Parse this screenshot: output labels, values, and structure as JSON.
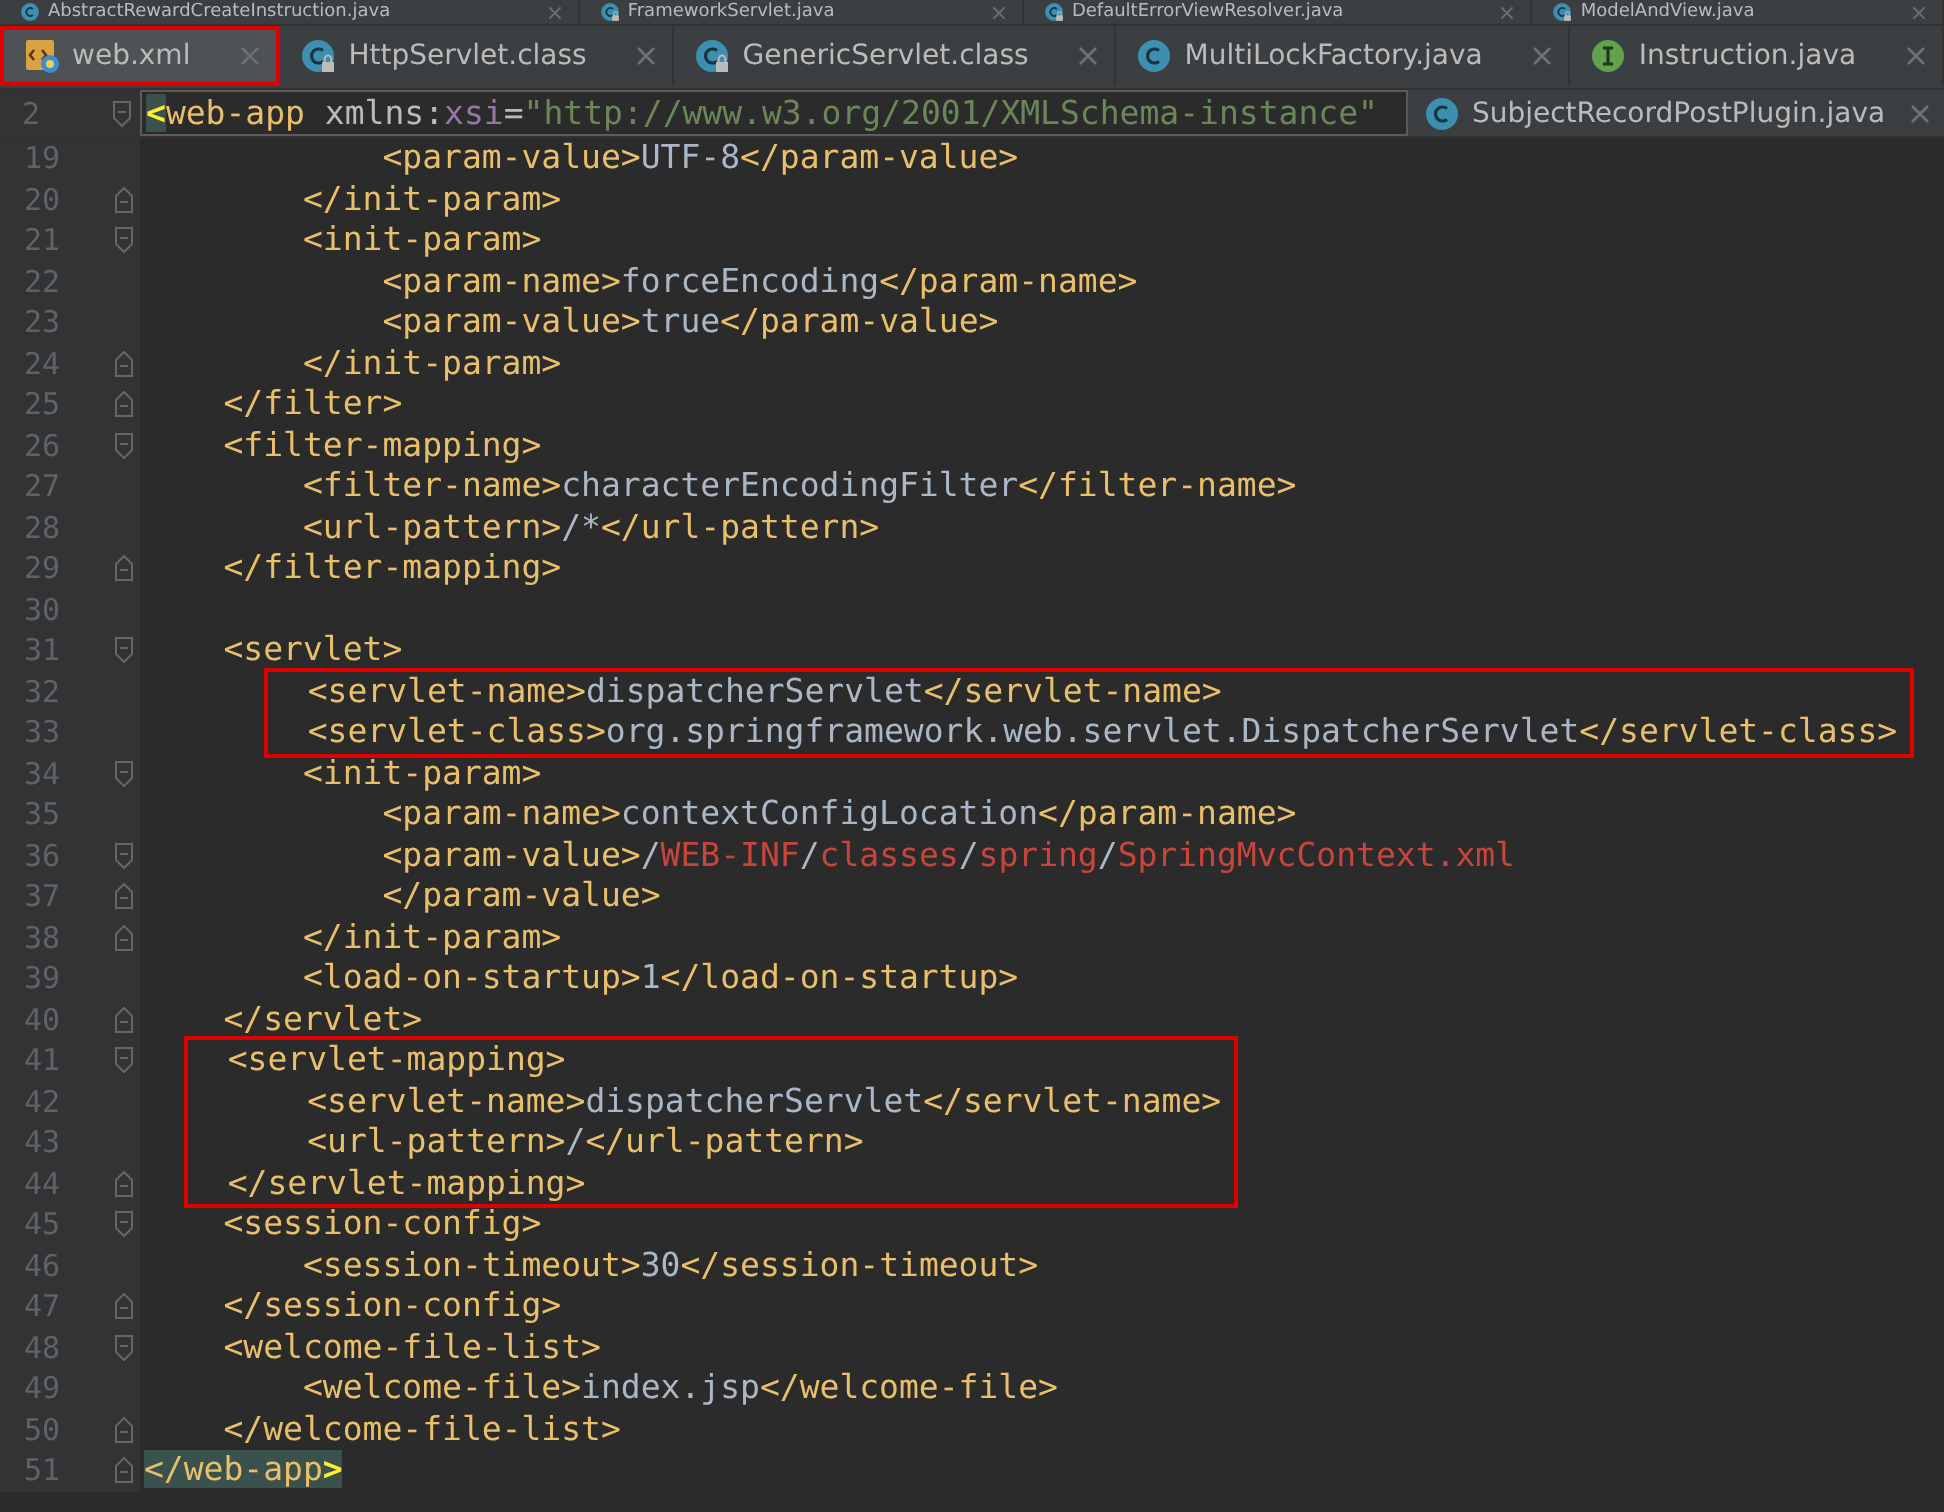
{
  "tab_rows": [
    [
      {
        "label": "AbstractRewardCreateInstruction.java",
        "kind": "class",
        "locked": false,
        "selected": false,
        "boxed": false
      },
      {
        "label": "FrameworkServlet.java",
        "kind": "class",
        "locked": true,
        "selected": false,
        "boxed": false
      },
      {
        "label": "DefaultErrorViewResolver.java",
        "kind": "class",
        "locked": true,
        "selected": false,
        "boxed": false
      },
      {
        "label": "ModelAndView.java",
        "kind": "class",
        "locked": true,
        "selected": false,
        "boxed": false
      }
    ],
    [
      {
        "label": "web.xml",
        "kind": "xml",
        "locked": false,
        "selected": true,
        "boxed": true
      },
      {
        "label": "HttpServlet.class",
        "kind": "class",
        "locked": true,
        "selected": false,
        "boxed": false
      },
      {
        "label": "GenericServlet.class",
        "kind": "class",
        "locked": true,
        "selected": false,
        "boxed": false
      },
      {
        "label": "MultiLockFactory.java",
        "kind": "class",
        "locked": false,
        "selected": false,
        "boxed": false
      },
      {
        "label": "Instruction.java",
        "kind": "interface",
        "locked": false,
        "selected": false,
        "boxed": false
      }
    ]
  ],
  "sticky_line": {
    "number": "2",
    "fold_start": true,
    "fold_end": false,
    "tokens": [
      {
        "kind": "match-brace",
        "text": "<"
      },
      {
        "kind": "tag",
        "text": "web-app "
      },
      {
        "kind": "attr",
        "text": "xmlns:"
      },
      {
        "kind": "ns",
        "text": "xsi"
      },
      {
        "kind": "attr",
        "text": "="
      },
      {
        "kind": "string",
        "text": "\"http://www.w3.org/2001/XMLSchema-instance\""
      }
    ]
  },
  "side_tab": {
    "label": "SubjectRecordPostPlugin.java",
    "kind": "class",
    "locked": false,
    "selected": false,
    "boxed": false
  },
  "code_blocks": [
    {
      "boxed": false,
      "lines": [
        {
          "number": "19",
          "fold_start": false,
          "fold_end": false,
          "tokens": [
            {
              "kind": "tag",
              "text": "            <param-value>"
            },
            {
              "kind": "text",
              "text": "UTF-8"
            },
            {
              "kind": "tag",
              "text": "</param-value>"
            }
          ]
        },
        {
          "number": "20",
          "fold_start": false,
          "fold_end": true,
          "tokens": [
            {
              "kind": "tag",
              "text": "        </init-param>"
            }
          ]
        },
        {
          "number": "21",
          "fold_start": true,
          "fold_end": false,
          "tokens": [
            {
              "kind": "tag",
              "text": "        <init-param>"
            }
          ]
        },
        {
          "number": "22",
          "fold_start": false,
          "fold_end": false,
          "tokens": [
            {
              "kind": "tag",
              "text": "            <param-name>"
            },
            {
              "kind": "text",
              "text": "forceEncoding"
            },
            {
              "kind": "tag",
              "text": "</param-name>"
            }
          ]
        },
        {
          "number": "23",
          "fold_start": false,
          "fold_end": false,
          "tokens": [
            {
              "kind": "tag",
              "text": "            <param-value>"
            },
            {
              "kind": "text",
              "text": "true"
            },
            {
              "kind": "tag",
              "text": "</param-value>"
            }
          ]
        },
        {
          "number": "24",
          "fold_start": false,
          "fold_end": true,
          "tokens": [
            {
              "kind": "tag",
              "text": "        </init-param>"
            }
          ]
        },
        {
          "number": "25",
          "fold_start": false,
          "fold_end": true,
          "tokens": [
            {
              "kind": "tag",
              "text": "    </filter>"
            }
          ]
        },
        {
          "number": "26",
          "fold_start": true,
          "fold_end": false,
          "tokens": [
            {
              "kind": "tag",
              "text": "    <filter-mapping>"
            }
          ]
        },
        {
          "number": "27",
          "fold_start": false,
          "fold_end": false,
          "tokens": [
            {
              "kind": "tag",
              "text": "        <filter-name>"
            },
            {
              "kind": "text",
              "text": "characterEncodingFilter"
            },
            {
              "kind": "tag",
              "text": "</filter-name>"
            }
          ]
        },
        {
          "number": "28",
          "fold_start": false,
          "fold_end": false,
          "tokens": [
            {
              "kind": "tag",
              "text": "        <url-pattern>"
            },
            {
              "kind": "text",
              "text": "/*"
            },
            {
              "kind": "tag",
              "text": "</url-pattern>"
            }
          ]
        },
        {
          "number": "29",
          "fold_start": false,
          "fold_end": true,
          "tokens": [
            {
              "kind": "tag",
              "text": "    </filter-mapping>"
            }
          ]
        },
        {
          "number": "30",
          "fold_start": false,
          "fold_end": false
        },
        {
          "number": "31",
          "fold_start": true,
          "fold_end": false,
          "tokens": [
            {
              "kind": "tag",
              "text": "    <servlet>"
            }
          ]
        }
      ]
    },
    {
      "boxed": true,
      "lines": [
        {
          "number": "32",
          "fold_start": false,
          "fold_end": false,
          "tokens": [
            {
              "kind": "tag",
              "text": "        <servlet-name>"
            },
            {
              "kind": "text",
              "text": "dispatcherServlet"
            },
            {
              "kind": "tag",
              "text": "</servlet-name>"
            }
          ]
        },
        {
          "number": "33",
          "fold_start": false,
          "fold_end": false,
          "tokens": [
            {
              "kind": "tag",
              "text": "        <servlet-class>"
            },
            {
              "kind": "text",
              "text": "org.springframework.web.servlet.DispatcherServlet"
            },
            {
              "kind": "tag",
              "text": "</servlet-class>"
            }
          ]
        }
      ]
    },
    {
      "boxed": false,
      "lines": [
        {
          "number": "34",
          "fold_start": true,
          "fold_end": false,
          "tokens": [
            {
              "kind": "tag",
              "text": "        <init-param>"
            }
          ]
        },
        {
          "number": "35",
          "fold_start": false,
          "fold_end": false,
          "tokens": [
            {
              "kind": "tag",
              "text": "            <param-name>"
            },
            {
              "kind": "text",
              "text": "contextConfigLocation"
            },
            {
              "kind": "tag",
              "text": "</param-name>"
            }
          ]
        },
        {
          "number": "36",
          "fold_start": true,
          "fold_end": false,
          "tokens": [
            {
              "kind": "tag",
              "text": "            <param-value>"
            },
            {
              "kind": "text",
              "text": "/"
            },
            {
              "kind": "path",
              "text": "WEB-INF"
            },
            {
              "kind": "text",
              "text": "/"
            },
            {
              "kind": "path",
              "text": "classes"
            },
            {
              "kind": "text",
              "text": "/"
            },
            {
              "kind": "path",
              "text": "spring"
            },
            {
              "kind": "text",
              "text": "/"
            },
            {
              "kind": "path",
              "text": "SpringMvcContext.xml"
            }
          ]
        },
        {
          "number": "37",
          "fold_start": false,
          "fold_end": true,
          "tokens": [
            {
              "kind": "tag",
              "text": "            </param-value>"
            }
          ]
        },
        {
          "number": "38",
          "fold_start": false,
          "fold_end": true,
          "tokens": [
            {
              "kind": "tag",
              "text": "        </init-param>"
            }
          ]
        },
        {
          "number": "39",
          "fold_start": false,
          "fold_end": false,
          "tokens": [
            {
              "kind": "tag",
              "text": "        <load-on-startup>"
            },
            {
              "kind": "text",
              "text": "1"
            },
            {
              "kind": "tag",
              "text": "</load-on-startup>"
            }
          ]
        },
        {
          "number": "40",
          "fold_start": false,
          "fold_end": true,
          "tokens": [
            {
              "kind": "tag",
              "text": "    </servlet>"
            }
          ]
        }
      ]
    },
    {
      "boxed": true,
      "lines": [
        {
          "number": "41",
          "fold_start": true,
          "fold_end": false,
          "tokens": [
            {
              "kind": "tag",
              "text": "    <servlet-mapping>"
            }
          ]
        },
        {
          "number": "42",
          "fold_start": false,
          "fold_end": false,
          "tokens": [
            {
              "kind": "tag",
              "text": "        <servlet-name>"
            },
            {
              "kind": "text",
              "text": "dispatcherServlet"
            },
            {
              "kind": "tag",
              "text": "</servlet-name>"
            }
          ]
        },
        {
          "number": "43",
          "fold_start": false,
          "fold_end": false,
          "tokens": [
            {
              "kind": "tag",
              "text": "        <url-pattern>"
            },
            {
              "kind": "text",
              "text": "/"
            },
            {
              "kind": "tag",
              "text": "</url-pattern>"
            }
          ]
        },
        {
          "number": "44",
          "fold_start": false,
          "fold_end": true,
          "tokens": [
            {
              "kind": "tag",
              "text": "    </servlet-mapping>"
            }
          ]
        }
      ]
    },
    {
      "boxed": false,
      "lines": [
        {
          "number": "45",
          "fold_start": true,
          "fold_end": false,
          "tokens": [
            {
              "kind": "tag",
              "text": "    <session-config>"
            }
          ]
        },
        {
          "number": "46",
          "fold_start": false,
          "fold_end": false,
          "tokens": [
            {
              "kind": "tag",
              "text": "        <session-timeout>"
            },
            {
              "kind": "text",
              "text": "30"
            },
            {
              "kind": "tag",
              "text": "</session-timeout>"
            }
          ]
        },
        {
          "number": "47",
          "fold_start": false,
          "fold_end": true,
          "tokens": [
            {
              "kind": "tag",
              "text": "    </session-config>"
            }
          ]
        },
        {
          "number": "48",
          "fold_start": true,
          "fold_end": false,
          "tokens": [
            {
              "kind": "tag",
              "text": "    <welcome-file-list>"
            }
          ]
        },
        {
          "number": "49",
          "fold_start": false,
          "fold_end": false,
          "tokens": [
            {
              "kind": "tag",
              "text": "        <welcome-file>"
            },
            {
              "kind": "text",
              "text": "index.jsp"
            },
            {
              "kind": "tag",
              "text": "</welcome-file>"
            }
          ]
        },
        {
          "number": "50",
          "fold_start": false,
          "fold_end": true,
          "tokens": [
            {
              "kind": "tag",
              "text": "    </welcome-file-list>"
            }
          ]
        },
        {
          "number": "51",
          "fold_start": false,
          "fold_end": true,
          "tokens": [
            {
              "kind": "match-tag",
              "text": "</web-app"
            },
            {
              "kind": "match-brace",
              "text": ">"
            }
          ]
        }
      ]
    }
  ]
}
